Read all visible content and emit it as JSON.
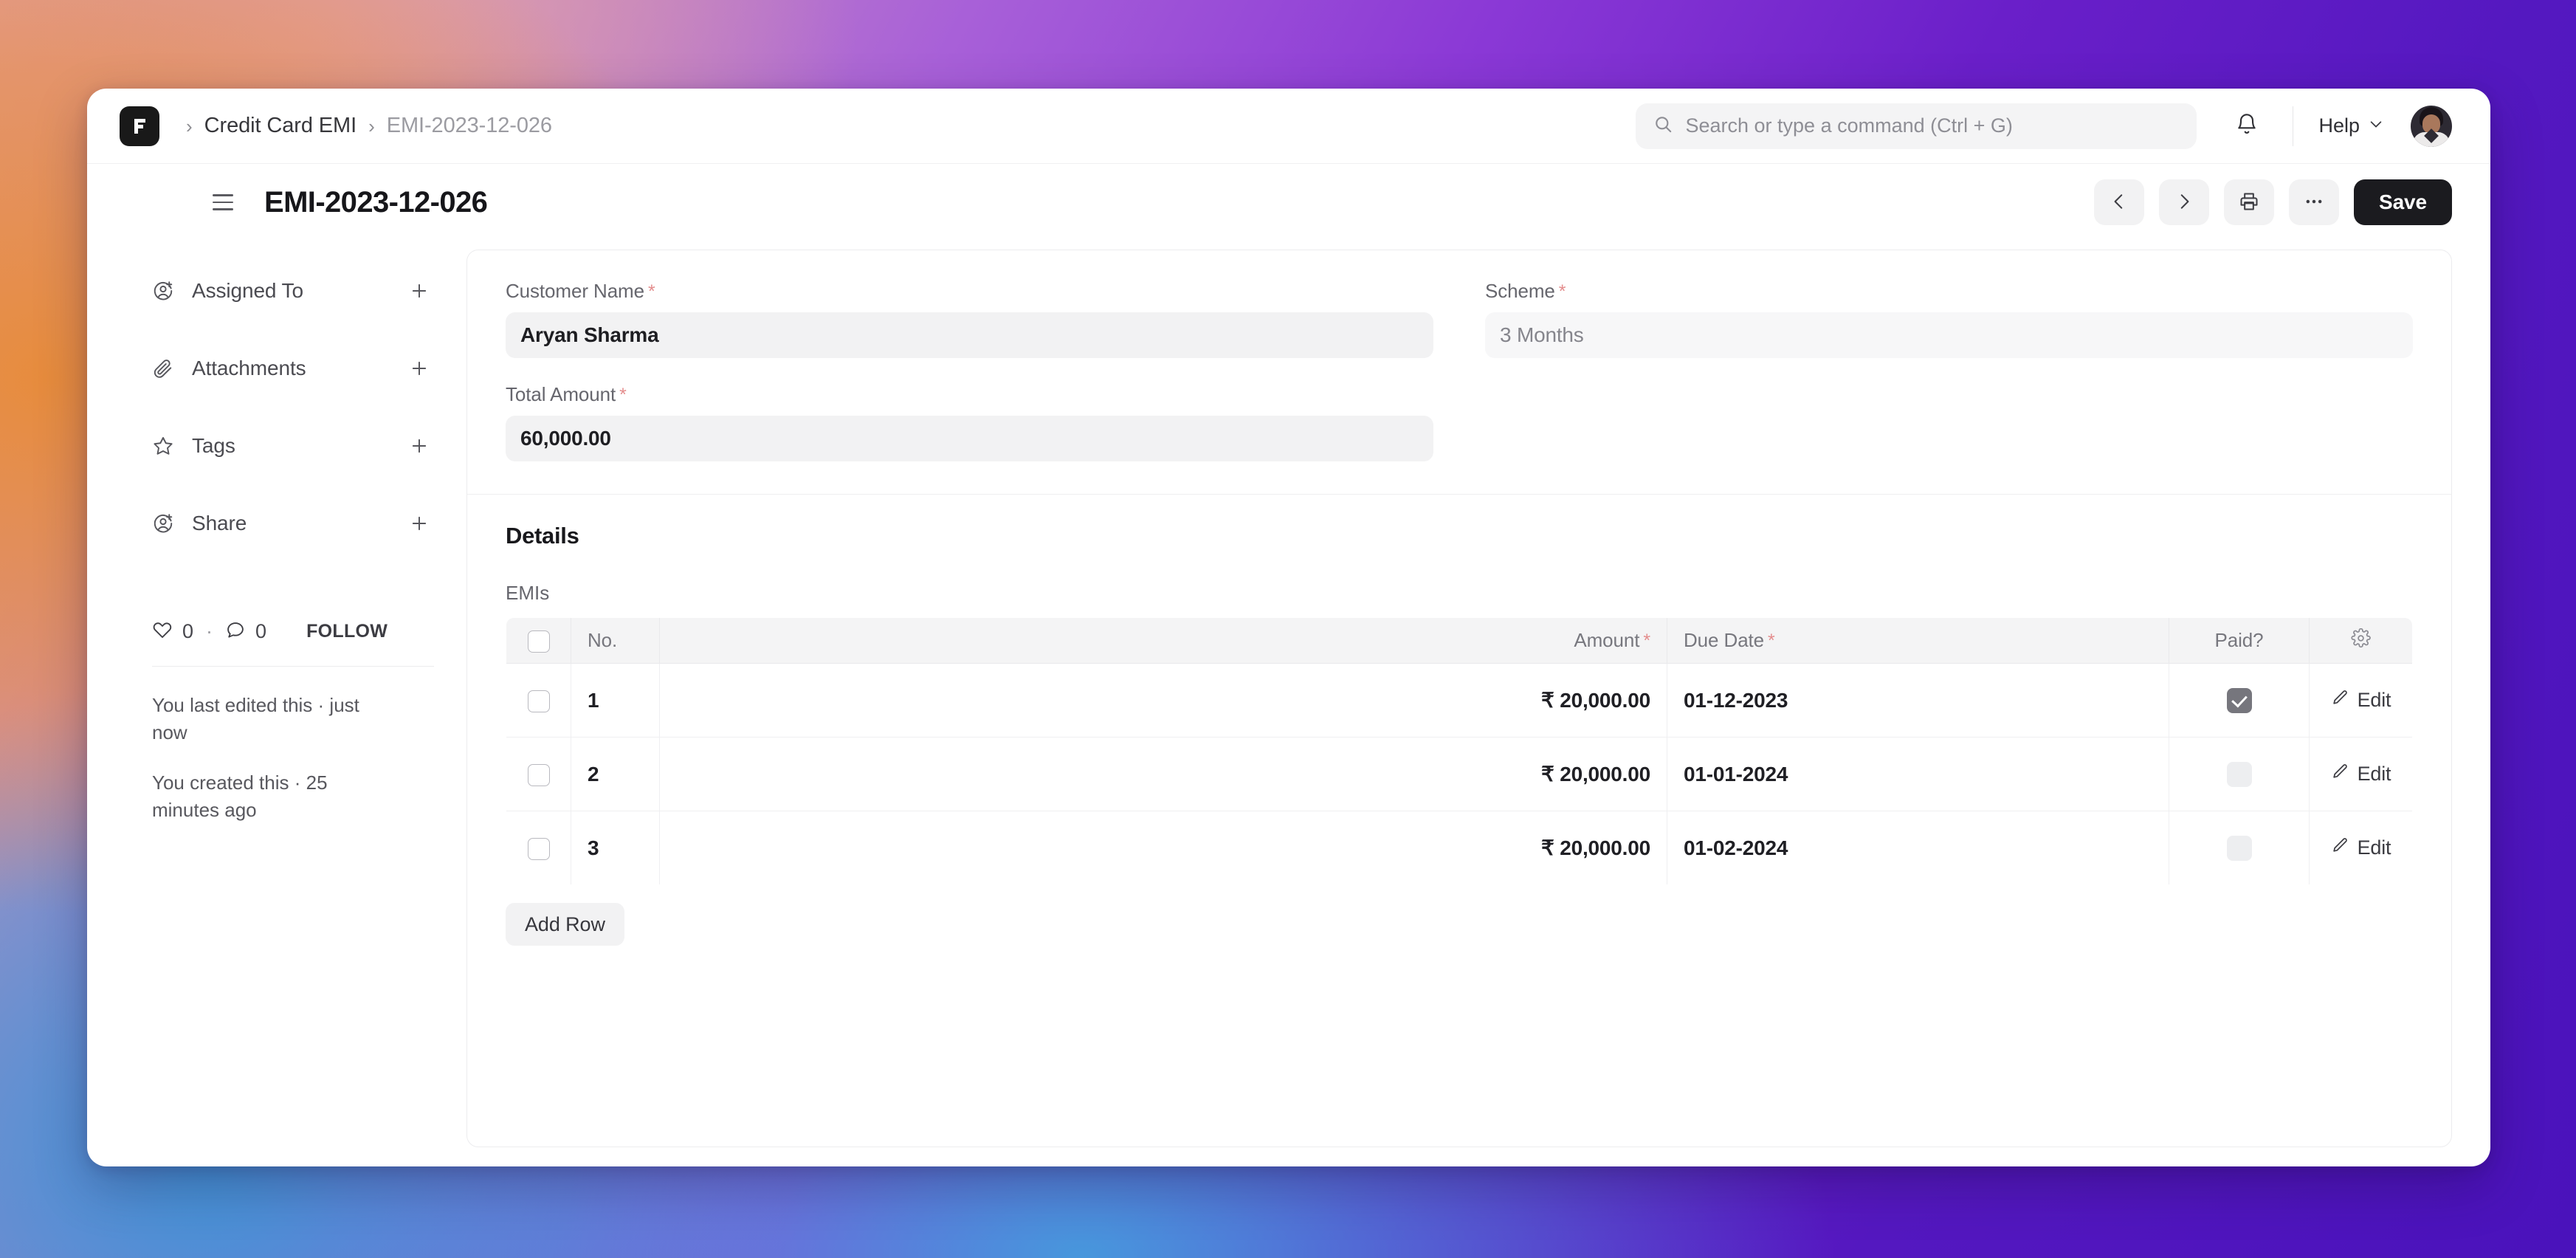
{
  "navbar": {
    "logo_letter": "F",
    "breadcrumbs": [
      {
        "label": "Credit Card EMI",
        "current": false
      },
      {
        "label": "EMI-2023-12-026",
        "current": true
      }
    ],
    "separator": "›",
    "search": {
      "placeholder": "Search or type a command (Ctrl + G)",
      "value": ""
    },
    "help_label": "Help"
  },
  "titlebar": {
    "title": "EMI-2023-12-026",
    "save_label": "Save"
  },
  "sidebar": {
    "items": [
      {
        "label": "Assigned To",
        "icon": "user-plus-icon"
      },
      {
        "label": "Attachments",
        "icon": "paperclip-icon"
      },
      {
        "label": "Tags",
        "icon": "star-icon"
      },
      {
        "label": "Share",
        "icon": "user-plus-icon"
      }
    ],
    "add_symbol": "+",
    "stats": {
      "likes": "0",
      "comments": "0",
      "separator": "·"
    },
    "follow_label": "FOLLOW",
    "meta": [
      "You last edited this · just now",
      "You created this · 25 minutes ago"
    ]
  },
  "form": {
    "fields": [
      {
        "label": "Customer Name",
        "required": true,
        "value": "Aryan Sharma",
        "readonly": false
      },
      {
        "label": "Total Amount",
        "required": true,
        "value": "60,000.00",
        "readonly": false
      },
      {
        "label": "Scheme",
        "required": true,
        "value": "3 Months",
        "readonly": true
      }
    ]
  },
  "details": {
    "title": "Details",
    "grid_label": "EMIs",
    "columns": [
      {
        "key": "check",
        "label": ""
      },
      {
        "key": "no",
        "label": "No."
      },
      {
        "key": "amount",
        "label": "Amount",
        "required": true
      },
      {
        "key": "due_date",
        "label": "Due Date",
        "required": true
      },
      {
        "key": "paid",
        "label": "Paid?"
      },
      {
        "key": "gear",
        "label": ""
      }
    ],
    "rows": [
      {
        "no": "1",
        "amount": "₹ 20,000.00",
        "due_date": "01-12-2023",
        "paid": true,
        "edit_label": "Edit"
      },
      {
        "no": "2",
        "amount": "₹ 20,000.00",
        "due_date": "01-01-2024",
        "paid": false,
        "edit_label": "Edit"
      },
      {
        "no": "3",
        "amount": "₹ 20,000.00",
        "due_date": "01-02-2024",
        "paid": false,
        "edit_label": "Edit"
      }
    ],
    "add_row_label": "Add Row"
  },
  "colors": {
    "accent_dark": "#1b1b1f",
    "required_asterisk": "#e48d8d",
    "field_bg": "#f2f2f3",
    "checked_box": "#76767d"
  }
}
